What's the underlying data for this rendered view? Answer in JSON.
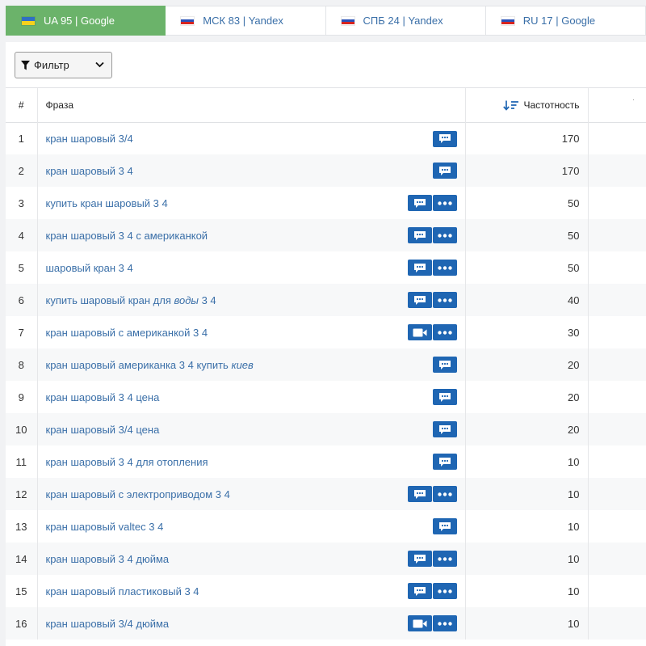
{
  "tabs": [
    {
      "label": "UA 95 | Google",
      "flag": [
        "#2f6fc4",
        "#f5d11d"
      ],
      "active": true
    },
    {
      "label": "МСК 83 | Yandex",
      "flag": [
        "#ffffff",
        "#2a51b8",
        "#d7241f"
      ],
      "active": false
    },
    {
      "label": "СПБ 24 | Yandex",
      "flag": [
        "#ffffff",
        "#2a51b8",
        "#d7241f"
      ],
      "active": false
    },
    {
      "label": "RU 17 | Google",
      "flag": [
        "#ffffff",
        "#2a51b8",
        "#d7241f"
      ],
      "active": false
    }
  ],
  "toolbar": {
    "filter_label": "Фильтр"
  },
  "table": {
    "headers": {
      "num": "#",
      "phrase": "Фраза",
      "freq": "Частотность"
    },
    "rows": [
      {
        "n": "1",
        "phrase": "кран шаровый 3/4",
        "freq": "170",
        "actions": [
          "comment"
        ]
      },
      {
        "n": "2",
        "phrase": "кран шаровый 3 4",
        "freq": "170",
        "actions": [
          "comment"
        ]
      },
      {
        "n": "3",
        "phrase": "купить кран шаровый 3 4",
        "freq": "50",
        "actions": [
          "comment",
          "more"
        ]
      },
      {
        "n": "4",
        "phrase": "кран шаровый 3 4 с американкой",
        "freq": "50",
        "actions": [
          "comment",
          "more"
        ]
      },
      {
        "n": "5",
        "phrase": "шаровый кран 3 4",
        "freq": "50",
        "actions": [
          "comment",
          "more"
        ]
      },
      {
        "n": "6",
        "phrase": [
          "купить шаровый кран для ",
          {
            "i": "воды"
          },
          " 3 4"
        ],
        "freq": "40",
        "actions": [
          "comment",
          "more"
        ]
      },
      {
        "n": "7",
        "phrase": "кран шаровый с американкой 3 4",
        "freq": "30",
        "actions": [
          "video",
          "more"
        ]
      },
      {
        "n": "8",
        "phrase": [
          "кран шаровый американка 3 4 купить ",
          {
            "i": "киев"
          }
        ],
        "freq": "20",
        "actions": [
          "comment"
        ]
      },
      {
        "n": "9",
        "phrase": "кран шаровый 3 4 цена",
        "freq": "20",
        "actions": [
          "comment"
        ]
      },
      {
        "n": "10",
        "phrase": "кран шаровый 3/4 цена",
        "freq": "20",
        "actions": [
          "comment"
        ]
      },
      {
        "n": "11",
        "phrase": "кран шаровый 3 4 для отопления",
        "freq": "10",
        "actions": [
          "comment"
        ]
      },
      {
        "n": "12",
        "phrase": "кран шаровый с электроприводом 3 4",
        "freq": "10",
        "actions": [
          "comment",
          "more"
        ]
      },
      {
        "n": "13",
        "phrase": "кран шаровый valtec 3 4",
        "freq": "10",
        "actions": [
          "comment"
        ]
      },
      {
        "n": "14",
        "phrase": "кран шаровый 3 4 дюйма",
        "freq": "10",
        "actions": [
          "comment",
          "more"
        ]
      },
      {
        "n": "15",
        "phrase": "кран шаровый пластиковый 3 4",
        "freq": "10",
        "actions": [
          "comment",
          "more"
        ]
      },
      {
        "n": "16",
        "phrase": "кран шаровый 3/4 дюйма",
        "freq": "10",
        "actions": [
          "video",
          "more"
        ]
      }
    ]
  },
  "colors": {
    "active_tab": "#6bb36a",
    "action_button": "#1f66b3",
    "link": "#3a6fa8"
  },
  "icons": {
    "filter": "funnel-icon",
    "dropdown": "chevron-down-icon",
    "sort": "sort-desc-icon",
    "comment": "comment-icon",
    "more": "more-icon",
    "video": "video-icon"
  }
}
